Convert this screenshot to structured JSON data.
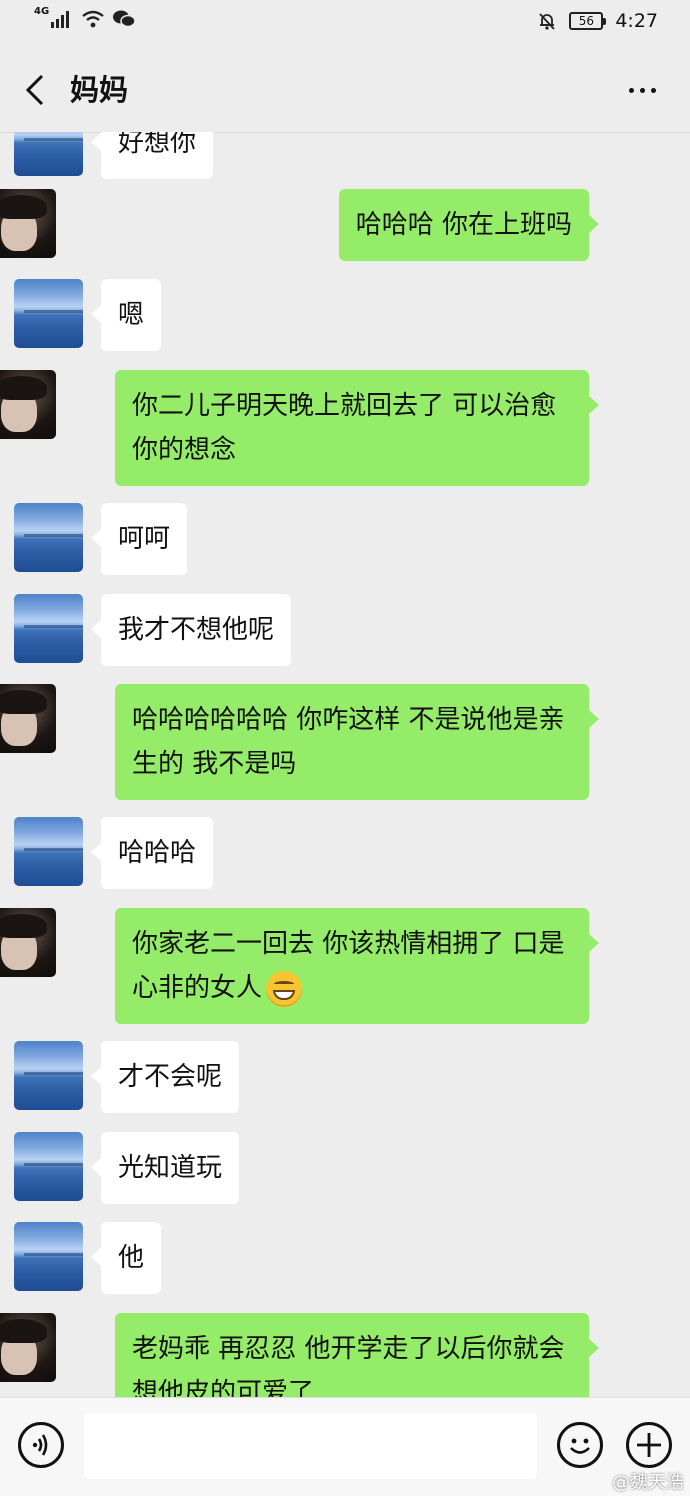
{
  "status_bar": {
    "network": "4G",
    "battery": "56",
    "time": "4:27"
  },
  "header": {
    "title": "妈妈"
  },
  "messages": [
    {
      "from": "mom",
      "text": "好想你"
    },
    {
      "from": "me",
      "text": "哈哈哈 你在上班吗"
    },
    {
      "from": "mom",
      "text": "嗯"
    },
    {
      "from": "me",
      "text": "你二儿子明天晚上就回去了 可以治愈你的想念"
    },
    {
      "from": "mom",
      "text": "呵呵"
    },
    {
      "from": "mom",
      "text": "我才不想他呢"
    },
    {
      "from": "me",
      "text": "哈哈哈哈哈哈 你咋这样 不是说他是亲生的 我不是吗"
    },
    {
      "from": "mom",
      "text": "哈哈哈"
    },
    {
      "from": "me",
      "text": "你家老二一回去 你该热情相拥了 口是心非的女人",
      "emoji": "grinning-face"
    },
    {
      "from": "mom",
      "text": "才不会呢"
    },
    {
      "from": "mom",
      "text": "光知道玩"
    },
    {
      "from": "mom",
      "text": "他"
    },
    {
      "from": "me",
      "text": "老妈乖 再忍忍 他开学走了以后你就会想他皮的可爱了"
    }
  ],
  "input": {
    "value": "",
    "placeholder": ""
  },
  "watermark": "@魏天浩"
}
